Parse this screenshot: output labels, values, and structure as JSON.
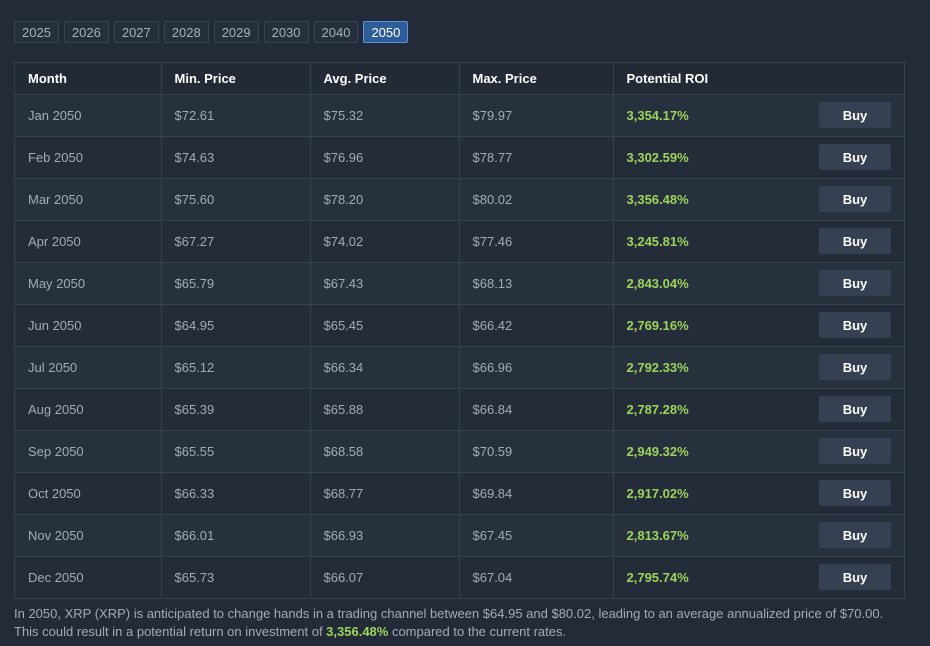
{
  "years": [
    "2025",
    "2026",
    "2027",
    "2028",
    "2029",
    "2030",
    "2040",
    "2050"
  ],
  "active_year": "2050",
  "table": {
    "headers": {
      "month": "Month",
      "min": "Min. Price",
      "avg": "Avg. Price",
      "max": "Max. Price",
      "roi": "Potential ROI"
    },
    "buy_label": "Buy",
    "rows": [
      {
        "month": "Jan 2050",
        "min": "$72.61",
        "avg": "$75.32",
        "max": "$79.97",
        "roi": "3,354.17%"
      },
      {
        "month": "Feb 2050",
        "min": "$74.63",
        "avg": "$76.96",
        "max": "$78.77",
        "roi": "3,302.59%"
      },
      {
        "month": "Mar 2050",
        "min": "$75.60",
        "avg": "$78.20",
        "max": "$80.02",
        "roi": "3,356.48%"
      },
      {
        "month": "Apr 2050",
        "min": "$67.27",
        "avg": "$74.02",
        "max": "$77.46",
        "roi": "3,245.81%"
      },
      {
        "month": "May 2050",
        "min": "$65.79",
        "avg": "$67.43",
        "max": "$68.13",
        "roi": "2,843.04%"
      },
      {
        "month": "Jun 2050",
        "min": "$64.95",
        "avg": "$65.45",
        "max": "$66.42",
        "roi": "2,769.16%"
      },
      {
        "month": "Jul 2050",
        "min": "$65.12",
        "avg": "$66.34",
        "max": "$66.96",
        "roi": "2,792.33%"
      },
      {
        "month": "Aug 2050",
        "min": "$65.39",
        "avg": "$65.88",
        "max": "$66.84",
        "roi": "2,787.28%"
      },
      {
        "month": "Sep 2050",
        "min": "$65.55",
        "avg": "$68.58",
        "max": "$70.59",
        "roi": "2,949.32%"
      },
      {
        "month": "Oct 2050",
        "min": "$66.33",
        "avg": "$68.77",
        "max": "$69.84",
        "roi": "2,917.02%"
      },
      {
        "month": "Nov 2050",
        "min": "$66.01",
        "avg": "$66.93",
        "max": "$67.45",
        "roi": "2,813.67%"
      },
      {
        "month": "Dec 2050",
        "min": "$65.73",
        "avg": "$66.07",
        "max": "$67.04",
        "roi": "2,795.74%"
      }
    ]
  },
  "summary": {
    "before": "In 2050, XRP (XRP) is anticipated to change hands in a trading channel between $64.95 and $80.02, leading to an average annualized price of $70.00. This could result in a potential return on investment of ",
    "highlight": "3,356.48%",
    "after": " compared to the current rates."
  },
  "colors": {
    "background": "#232b38",
    "roi_green": "#9cd45a",
    "active_tab": "#2e5d9a",
    "buy_button": "#364053"
  }
}
